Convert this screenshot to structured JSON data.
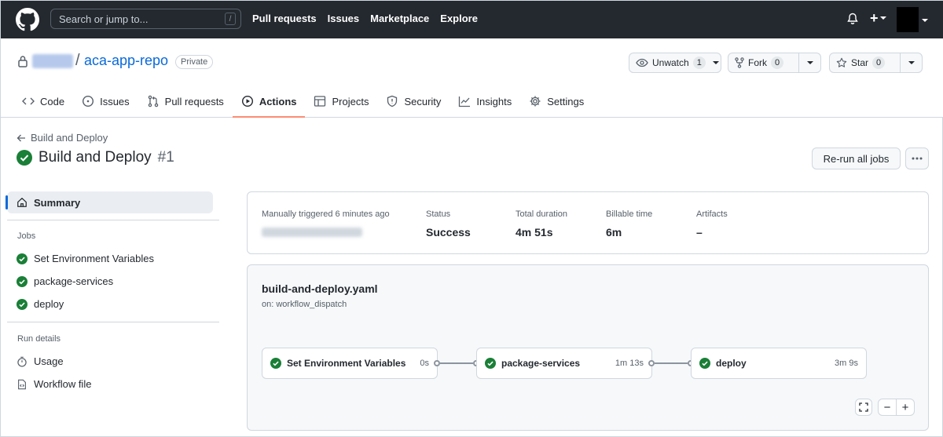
{
  "header": {
    "search_placeholder": "Search or jump to...",
    "search_shortcut": "/",
    "nav": [
      "Pull requests",
      "Issues",
      "Marketplace",
      "Explore"
    ],
    "plus_label": "+"
  },
  "repo": {
    "separator": "/",
    "name": "aca-app-repo",
    "visibility": "Private",
    "watch": {
      "label": "Unwatch",
      "count": "1"
    },
    "fork": {
      "label": "Fork",
      "count": "0"
    },
    "star": {
      "label": "Star",
      "count": "0"
    },
    "tabs": [
      {
        "label": "Code",
        "icon": "code-icon"
      },
      {
        "label": "Issues",
        "icon": "issue-icon"
      },
      {
        "label": "Pull requests",
        "icon": "pull-request-icon"
      },
      {
        "label": "Actions",
        "icon": "play-icon",
        "active": true
      },
      {
        "label": "Projects",
        "icon": "table-icon"
      },
      {
        "label": "Security",
        "icon": "shield-icon"
      },
      {
        "label": "Insights",
        "icon": "graph-icon"
      },
      {
        "label": "Settings",
        "icon": "gear-icon"
      }
    ]
  },
  "run": {
    "back_label": "Build and Deploy",
    "title": "Build and Deploy",
    "number": "#1",
    "rerun_label": "Re-run all jobs"
  },
  "sidebar": {
    "summary_label": "Summary",
    "jobs_heading": "Jobs",
    "jobs": [
      "Set Environment Variables",
      "package-services",
      "deploy"
    ],
    "run_details_heading": "Run details",
    "details": [
      "Usage",
      "Workflow file"
    ]
  },
  "summary": {
    "trigger_label": "Manually triggered 6 minutes ago",
    "status_label": "Status",
    "status_value": "Success",
    "duration_label": "Total duration",
    "duration_value": "4m 51s",
    "billable_label": "Billable time",
    "billable_value": "6m",
    "artifacts_label": "Artifacts",
    "artifacts_value": "–"
  },
  "workflow": {
    "file": "build-and-deploy.yaml",
    "trigger": "on: workflow_dispatch",
    "jobs": [
      {
        "name": "Set Environment Variables",
        "duration": "0s"
      },
      {
        "name": "package-services",
        "duration": "1m 13s"
      },
      {
        "name": "deploy",
        "duration": "3m 9s"
      }
    ],
    "zoom_out": "−",
    "zoom_in": "+"
  },
  "colors": {
    "success": "#1a7f37",
    "header_bg": "#24292f",
    "link": "#0969da",
    "active_tab_underline": "#fd8c73"
  }
}
